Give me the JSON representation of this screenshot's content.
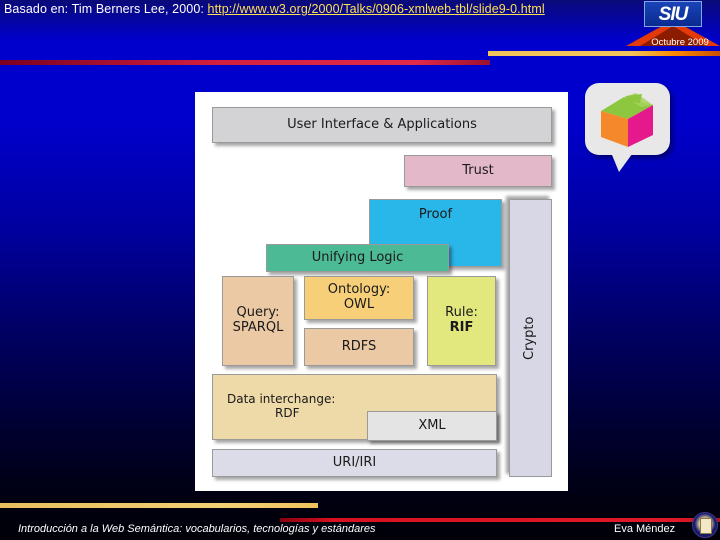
{
  "header": {
    "prefix": "Basado en: Tim Berners Lee, 2000: ",
    "link": "http://www.w3.org/2000/Talks/0906-xmlweb-tbl/slide9-0.html",
    "logo_text": "SIU",
    "date": "Octubre 2009"
  },
  "footer": {
    "left": "Introducción a la Web Semántica: vocabularios, tecnologías y estándares",
    "right": "Eva Méndez"
  },
  "colors": {
    "background_top": "#0000cc",
    "background_bottom": "#000010",
    "link": "#ffe14d",
    "red_bar": "#d42040",
    "gold_bar": "#f0c35c",
    "panel": "#ffffff"
  },
  "chart_data": {
    "type": "diagram",
    "title": "Semantic Web Stack",
    "layers": [
      {
        "id": "ui",
        "label": "User Interface & Applications",
        "color": "#d3d3d6"
      },
      {
        "id": "trust",
        "label": "Trust",
        "color": "#e3b8c8"
      },
      {
        "id": "proof",
        "label": "Proof",
        "color": "#29b6e8"
      },
      {
        "id": "logic",
        "label": "Unifying Logic",
        "color": "#4cba94"
      },
      {
        "id": "query",
        "label": "Query:\nSPARQL",
        "color": "#eac9a4"
      },
      {
        "id": "owl",
        "label": "Ontology:\nOWL",
        "color": "#f7cf79"
      },
      {
        "id": "rdfs",
        "label": "RDFS",
        "color": "#eac9a4"
      },
      {
        "id": "rif",
        "label": "Rule:\nRIF",
        "color": "#e2e87e"
      },
      {
        "id": "rdf",
        "label": "Data interchange:\nRDF",
        "color": "#eed9a8"
      },
      {
        "id": "xml",
        "label": "XML",
        "color": "#e4e4e4"
      },
      {
        "id": "uri",
        "label": "URI/IRI",
        "color": "#dcdce8"
      },
      {
        "id": "crypto",
        "label": "Crypto",
        "color": "#d7d7e6"
      }
    ],
    "blocks": {
      "ui": {
        "label_l1": "User Interface & Applications",
        "label_l2": ""
      },
      "trust": {
        "label_l1": "Trust",
        "label_l2": ""
      },
      "proof": {
        "label_l1": "Proof",
        "label_l2": ""
      },
      "logic": {
        "label_l1": "Unifying Logic",
        "label_l2": ""
      },
      "query": {
        "label_l1": "Query:",
        "label_l2": "SPARQL"
      },
      "owl": {
        "label_l1": "Ontology:",
        "label_l2": "OWL"
      },
      "rdfs": {
        "label_l1": "RDFS",
        "label_l2": ""
      },
      "rif": {
        "label_l1": "Rule:",
        "label_l2": "RIF"
      },
      "rdf": {
        "label_l1": "Data interchange:",
        "label_l2": "RDF"
      },
      "xml": {
        "label_l1": "XML",
        "label_l2": ""
      },
      "uri": {
        "label_l1": "URI/IRI",
        "label_l2": ""
      },
      "crypto": {
        "label_l1": "Crypto",
        "label_l2": ""
      }
    }
  }
}
